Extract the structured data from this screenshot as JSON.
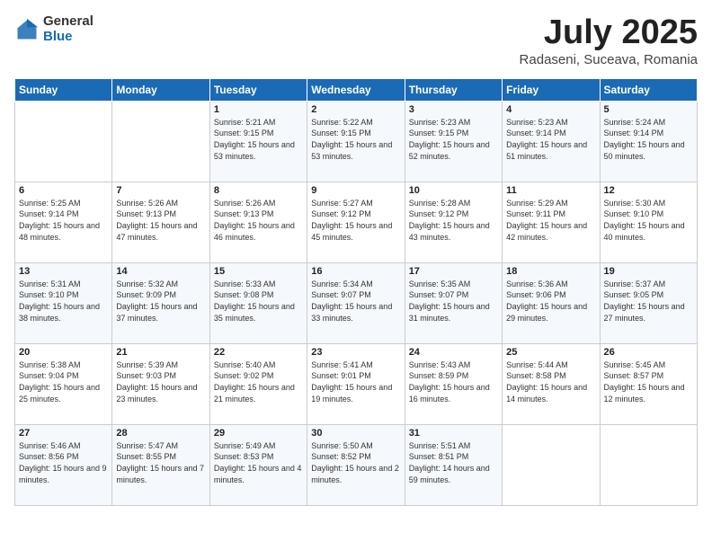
{
  "logo": {
    "general": "General",
    "blue": "Blue"
  },
  "title": {
    "month_year": "July 2025",
    "location": "Radaseni, Suceava, Romania"
  },
  "days_of_week": [
    "Sunday",
    "Monday",
    "Tuesday",
    "Wednesday",
    "Thursday",
    "Friday",
    "Saturday"
  ],
  "weeks": [
    [
      {
        "day": "",
        "info": ""
      },
      {
        "day": "",
        "info": ""
      },
      {
        "day": "1",
        "sunrise": "Sunrise: 5:21 AM",
        "sunset": "Sunset: 9:15 PM",
        "daylight": "Daylight: 15 hours and 53 minutes."
      },
      {
        "day": "2",
        "sunrise": "Sunrise: 5:22 AM",
        "sunset": "Sunset: 9:15 PM",
        "daylight": "Daylight: 15 hours and 53 minutes."
      },
      {
        "day": "3",
        "sunrise": "Sunrise: 5:23 AM",
        "sunset": "Sunset: 9:15 PM",
        "daylight": "Daylight: 15 hours and 52 minutes."
      },
      {
        "day": "4",
        "sunrise": "Sunrise: 5:23 AM",
        "sunset": "Sunset: 9:14 PM",
        "daylight": "Daylight: 15 hours and 51 minutes."
      },
      {
        "day": "5",
        "sunrise": "Sunrise: 5:24 AM",
        "sunset": "Sunset: 9:14 PM",
        "daylight": "Daylight: 15 hours and 50 minutes."
      }
    ],
    [
      {
        "day": "6",
        "sunrise": "Sunrise: 5:25 AM",
        "sunset": "Sunset: 9:14 PM",
        "daylight": "Daylight: 15 hours and 48 minutes."
      },
      {
        "day": "7",
        "sunrise": "Sunrise: 5:26 AM",
        "sunset": "Sunset: 9:13 PM",
        "daylight": "Daylight: 15 hours and 47 minutes."
      },
      {
        "day": "8",
        "sunrise": "Sunrise: 5:26 AM",
        "sunset": "Sunset: 9:13 PM",
        "daylight": "Daylight: 15 hours and 46 minutes."
      },
      {
        "day": "9",
        "sunrise": "Sunrise: 5:27 AM",
        "sunset": "Sunset: 9:12 PM",
        "daylight": "Daylight: 15 hours and 45 minutes."
      },
      {
        "day": "10",
        "sunrise": "Sunrise: 5:28 AM",
        "sunset": "Sunset: 9:12 PM",
        "daylight": "Daylight: 15 hours and 43 minutes."
      },
      {
        "day": "11",
        "sunrise": "Sunrise: 5:29 AM",
        "sunset": "Sunset: 9:11 PM",
        "daylight": "Daylight: 15 hours and 42 minutes."
      },
      {
        "day": "12",
        "sunrise": "Sunrise: 5:30 AM",
        "sunset": "Sunset: 9:10 PM",
        "daylight": "Daylight: 15 hours and 40 minutes."
      }
    ],
    [
      {
        "day": "13",
        "sunrise": "Sunrise: 5:31 AM",
        "sunset": "Sunset: 9:10 PM",
        "daylight": "Daylight: 15 hours and 38 minutes."
      },
      {
        "day": "14",
        "sunrise": "Sunrise: 5:32 AM",
        "sunset": "Sunset: 9:09 PM",
        "daylight": "Daylight: 15 hours and 37 minutes."
      },
      {
        "day": "15",
        "sunrise": "Sunrise: 5:33 AM",
        "sunset": "Sunset: 9:08 PM",
        "daylight": "Daylight: 15 hours and 35 minutes."
      },
      {
        "day": "16",
        "sunrise": "Sunrise: 5:34 AM",
        "sunset": "Sunset: 9:07 PM",
        "daylight": "Daylight: 15 hours and 33 minutes."
      },
      {
        "day": "17",
        "sunrise": "Sunrise: 5:35 AM",
        "sunset": "Sunset: 9:07 PM",
        "daylight": "Daylight: 15 hours and 31 minutes."
      },
      {
        "day": "18",
        "sunrise": "Sunrise: 5:36 AM",
        "sunset": "Sunset: 9:06 PM",
        "daylight": "Daylight: 15 hours and 29 minutes."
      },
      {
        "day": "19",
        "sunrise": "Sunrise: 5:37 AM",
        "sunset": "Sunset: 9:05 PM",
        "daylight": "Daylight: 15 hours and 27 minutes."
      }
    ],
    [
      {
        "day": "20",
        "sunrise": "Sunrise: 5:38 AM",
        "sunset": "Sunset: 9:04 PM",
        "daylight": "Daylight: 15 hours and 25 minutes."
      },
      {
        "day": "21",
        "sunrise": "Sunrise: 5:39 AM",
        "sunset": "Sunset: 9:03 PM",
        "daylight": "Daylight: 15 hours and 23 minutes."
      },
      {
        "day": "22",
        "sunrise": "Sunrise: 5:40 AM",
        "sunset": "Sunset: 9:02 PM",
        "daylight": "Daylight: 15 hours and 21 minutes."
      },
      {
        "day": "23",
        "sunrise": "Sunrise: 5:41 AM",
        "sunset": "Sunset: 9:01 PM",
        "daylight": "Daylight: 15 hours and 19 minutes."
      },
      {
        "day": "24",
        "sunrise": "Sunrise: 5:43 AM",
        "sunset": "Sunset: 8:59 PM",
        "daylight": "Daylight: 15 hours and 16 minutes."
      },
      {
        "day": "25",
        "sunrise": "Sunrise: 5:44 AM",
        "sunset": "Sunset: 8:58 PM",
        "daylight": "Daylight: 15 hours and 14 minutes."
      },
      {
        "day": "26",
        "sunrise": "Sunrise: 5:45 AM",
        "sunset": "Sunset: 8:57 PM",
        "daylight": "Daylight: 15 hours and 12 minutes."
      }
    ],
    [
      {
        "day": "27",
        "sunrise": "Sunrise: 5:46 AM",
        "sunset": "Sunset: 8:56 PM",
        "daylight": "Daylight: 15 hours and 9 minutes."
      },
      {
        "day": "28",
        "sunrise": "Sunrise: 5:47 AM",
        "sunset": "Sunset: 8:55 PM",
        "daylight": "Daylight: 15 hours and 7 minutes."
      },
      {
        "day": "29",
        "sunrise": "Sunrise: 5:49 AM",
        "sunset": "Sunset: 8:53 PM",
        "daylight": "Daylight: 15 hours and 4 minutes."
      },
      {
        "day": "30",
        "sunrise": "Sunrise: 5:50 AM",
        "sunset": "Sunset: 8:52 PM",
        "daylight": "Daylight: 15 hours and 2 minutes."
      },
      {
        "day": "31",
        "sunrise": "Sunrise: 5:51 AM",
        "sunset": "Sunset: 8:51 PM",
        "daylight": "Daylight: 14 hours and 59 minutes."
      },
      {
        "day": "",
        "info": ""
      },
      {
        "day": "",
        "info": ""
      }
    ]
  ]
}
